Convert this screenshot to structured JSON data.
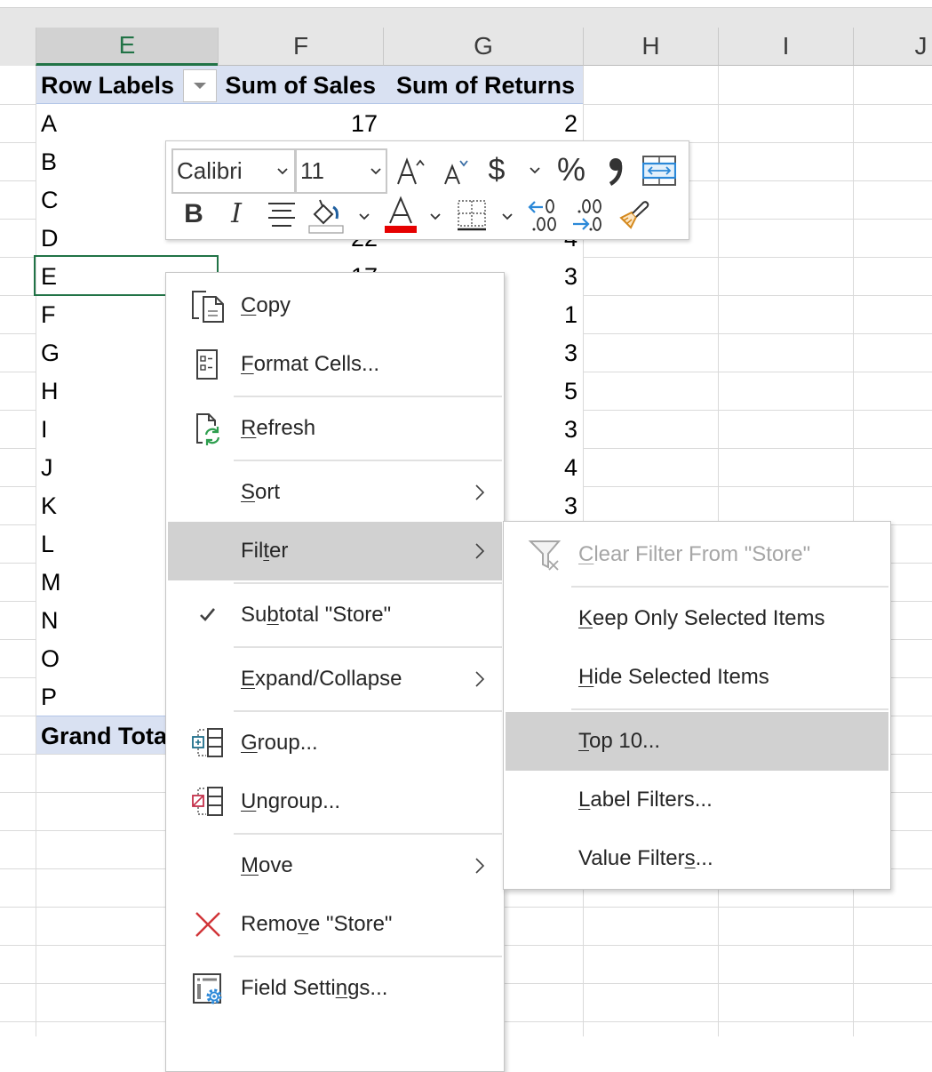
{
  "sheet": {
    "column_headers": [
      {
        "letter": "E",
        "selected": true
      },
      {
        "letter": "F"
      },
      {
        "letter": "G"
      },
      {
        "letter": "H"
      },
      {
        "letter": "I"
      },
      {
        "letter": "J"
      }
    ],
    "colors": {
      "selection": "#217346",
      "pivot_header_bg": "#d9e1f2",
      "menu_highlight": "#d1d1d1"
    }
  },
  "pivot": {
    "headers": {
      "row_labels": "Row Labels",
      "sum_of_sales": "Sum of Sales",
      "sum_of_returns": "Sum of Returns"
    },
    "rows": [
      {
        "label": "A",
        "sales": "17",
        "returns": "2"
      },
      {
        "label": "B"
      },
      {
        "label": "C"
      },
      {
        "label": "D",
        "sales": "22",
        "returns": "4"
      },
      {
        "label": "E",
        "sales": "17",
        "returns": "3"
      },
      {
        "label": "F",
        "returns": "1"
      },
      {
        "label": "G",
        "returns": "3"
      },
      {
        "label": "H",
        "returns": "5"
      },
      {
        "label": "I",
        "returns": "3"
      },
      {
        "label": "J",
        "returns": "4"
      },
      {
        "label": "K",
        "returns": "3"
      },
      {
        "label": "L"
      },
      {
        "label": "M"
      },
      {
        "label": "N"
      },
      {
        "label": "O"
      },
      {
        "label": "P"
      }
    ],
    "grand_total_label": "Grand Total"
  },
  "mini_toolbar": {
    "font_name": "Calibri",
    "font_size": "11",
    "bold_glyph": "B",
    "italic_glyph": "I",
    "currency_glyph": "$",
    "percent_glyph": "%",
    "font_color": "#e60000",
    "fill_color": "#ffffff"
  },
  "context_menu": {
    "items": [
      {
        "id": "copy",
        "label": "Copy",
        "access_key": 0,
        "icon": "copy-icon"
      },
      {
        "id": "format-cells",
        "label": "Format Cells...",
        "access_key": 0,
        "icon": "format-cells-icon"
      },
      {
        "separator": true
      },
      {
        "id": "refresh",
        "label": "Refresh",
        "access_key": 0,
        "icon": "refresh-icon"
      },
      {
        "separator": true
      },
      {
        "id": "sort",
        "label": "Sort",
        "access_key": 0,
        "submenu": true
      },
      {
        "id": "filter",
        "label": "Filter",
        "access_key": 3,
        "submenu": true,
        "highlighted": true
      },
      {
        "separator": true
      },
      {
        "id": "subtotal-store",
        "label": "Subtotal \"Store\"",
        "access_key": 2,
        "checked": true
      },
      {
        "separator": true
      },
      {
        "id": "expand-collapse",
        "label": "Expand/Collapse",
        "access_key": 0,
        "submenu": true
      },
      {
        "separator": true
      },
      {
        "id": "group",
        "label": "Group...",
        "access_key": 0,
        "icon": "group-icon"
      },
      {
        "id": "ungroup",
        "label": "Ungroup...",
        "access_key": 0,
        "icon": "ungroup-icon"
      },
      {
        "separator": true
      },
      {
        "id": "move",
        "label": "Move",
        "access_key": 0,
        "submenu": true
      },
      {
        "id": "remove-store",
        "label": "Remove \"Store\"",
        "access_key": 4,
        "icon": "remove-icon"
      },
      {
        "separator": true
      },
      {
        "id": "field-settings",
        "label": "Field Settings...",
        "access_key": 11,
        "icon": "field-settings-icon"
      }
    ]
  },
  "filter_submenu": {
    "items": [
      {
        "id": "clear-filter",
        "label": "Clear Filter From \"Store\"",
        "access_key": 0,
        "disabled": true,
        "icon": "clear-filter-icon"
      },
      {
        "separator": true
      },
      {
        "id": "keep-only-selected-items",
        "label": "Keep Only Selected Items",
        "access_key": 0
      },
      {
        "id": "hide-selected-items",
        "label": "Hide Selected Items",
        "access_key": 0
      },
      {
        "separator": true
      },
      {
        "id": "top-10",
        "label": "Top 10...",
        "access_key": 0,
        "highlighted": true
      },
      {
        "id": "label-filters",
        "label": "Label Filters...",
        "access_key": 0
      },
      {
        "id": "value-filters",
        "label": "Value Filters...",
        "access_key": 12
      }
    ]
  }
}
